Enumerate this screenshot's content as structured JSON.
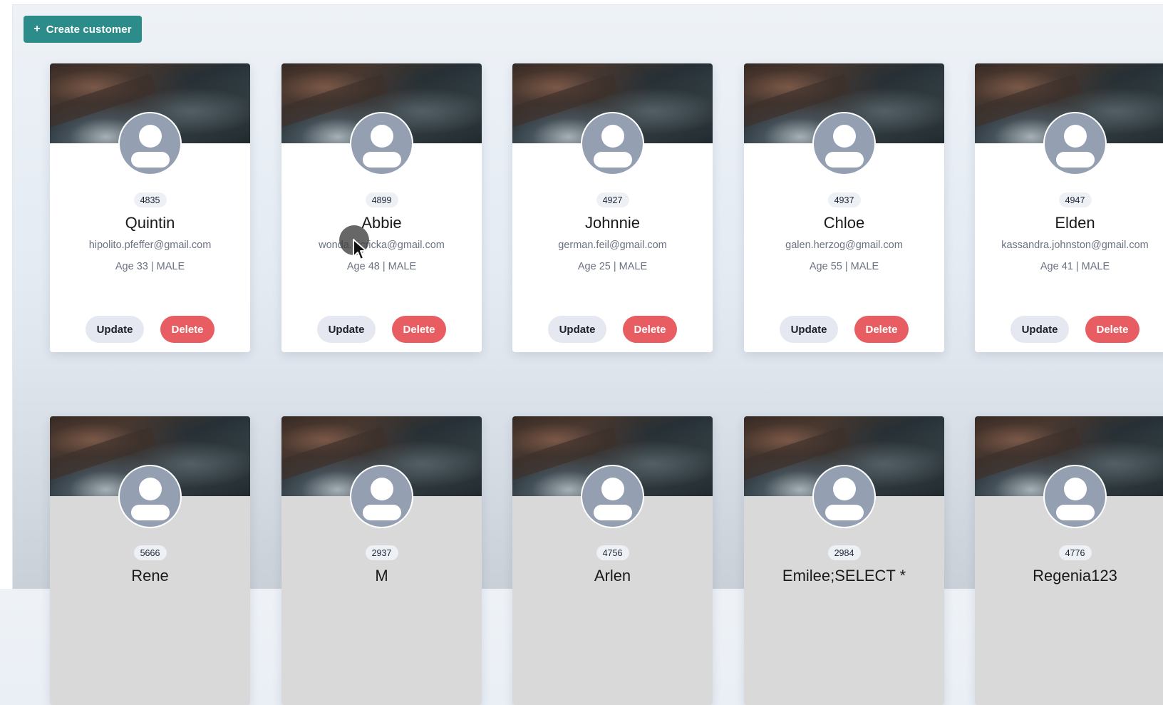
{
  "toolbar": {
    "create_label": "Create customer",
    "create_icon": "+"
  },
  "customers": [
    {
      "id": "4835",
      "name": "Quintin",
      "email": "hipolito.pfeffer@gmail.com",
      "meta": "Age 33 | MALE"
    },
    {
      "id": "4899",
      "name": "Abbie",
      "email": "wonda.dicricka@gmail.com",
      "meta": "Age 48 | MALE"
    },
    {
      "id": "4927",
      "name": "Johnnie",
      "email": "german.feil@gmail.com",
      "meta": "Age 25 | MALE"
    },
    {
      "id": "4937",
      "name": "Chloe",
      "email": "galen.herzog@gmail.com",
      "meta": "Age 55 | MALE"
    },
    {
      "id": "4947",
      "name": "Elden",
      "email": "kassandra.johnston@gmail.com",
      "meta": "Age 41 | MALE"
    },
    {
      "id": "5666",
      "name": "Rene"
    },
    {
      "id": "2937",
      "name": "M"
    },
    {
      "id": "4756",
      "name": "Arlen"
    },
    {
      "id": "2984",
      "name": "Emilee;SELECT *"
    },
    {
      "id": "4776",
      "name": "Regenia123"
    }
  ],
  "actions": {
    "update_label": "Update",
    "delete_label": "Delete"
  },
  "colors": {
    "primary": "#2c8c8a",
    "delete": "#e85d62",
    "update_bg": "#e5e8f0",
    "avatar": "#94a0b2"
  }
}
